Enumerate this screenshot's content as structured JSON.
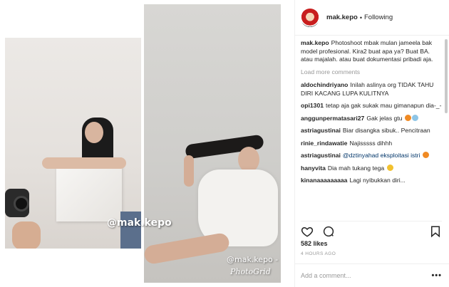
{
  "post": {
    "username": "mak.kepo",
    "follow_status": "Following",
    "separator": "•",
    "caption": "Photoshoot mbak mulan jameela bak model profesional. Kira2 buat apa ya? Buat BA. atau majalah. atau buat dokumentasi pribadi aja.",
    "load_more": "Load more comments",
    "likes": "582 likes",
    "time_ago": "4 HOURS AGO",
    "add_comment_placeholder": "Add a comment...",
    "more_label": "•••"
  },
  "watermarks": {
    "big": "@mak.kepo",
    "small": "@mak.kepo -",
    "grid": "PhotoGrid"
  },
  "comments": [
    {
      "user": "aldochindriyano",
      "text": "Inilah aslinya org TIDAK TAHU DIRI KACANG LUPA KULITNYA"
    },
    {
      "user": "opi1301",
      "text": "tetap aja gak sukak mau gimanapun dia-_-"
    },
    {
      "user": "anggunpermatasari27",
      "text": "Gak jelas gtu"
    },
    {
      "user": "astriagustinai",
      "text": "Biar disangka sibuk.. Pencitraan"
    },
    {
      "user": "rinie_rindawatie",
      "text": "Najisssss dihhh"
    },
    {
      "user": "astriagustinai",
      "text": "@dztinyahad eksploitasi istri"
    },
    {
      "user": "hanyvita",
      "text": "Dia mah tukang tega"
    },
    {
      "user": "kinanaaaaaaaaa",
      "text": "Lagi nyibukkan diri..."
    }
  ],
  "icons": {
    "like": "heart-icon",
    "comment": "comment-icon",
    "save": "bookmark-icon"
  },
  "colors": {
    "text": "#262626",
    "muted": "#999999",
    "mention": "#003569",
    "border": "#efefef"
  }
}
